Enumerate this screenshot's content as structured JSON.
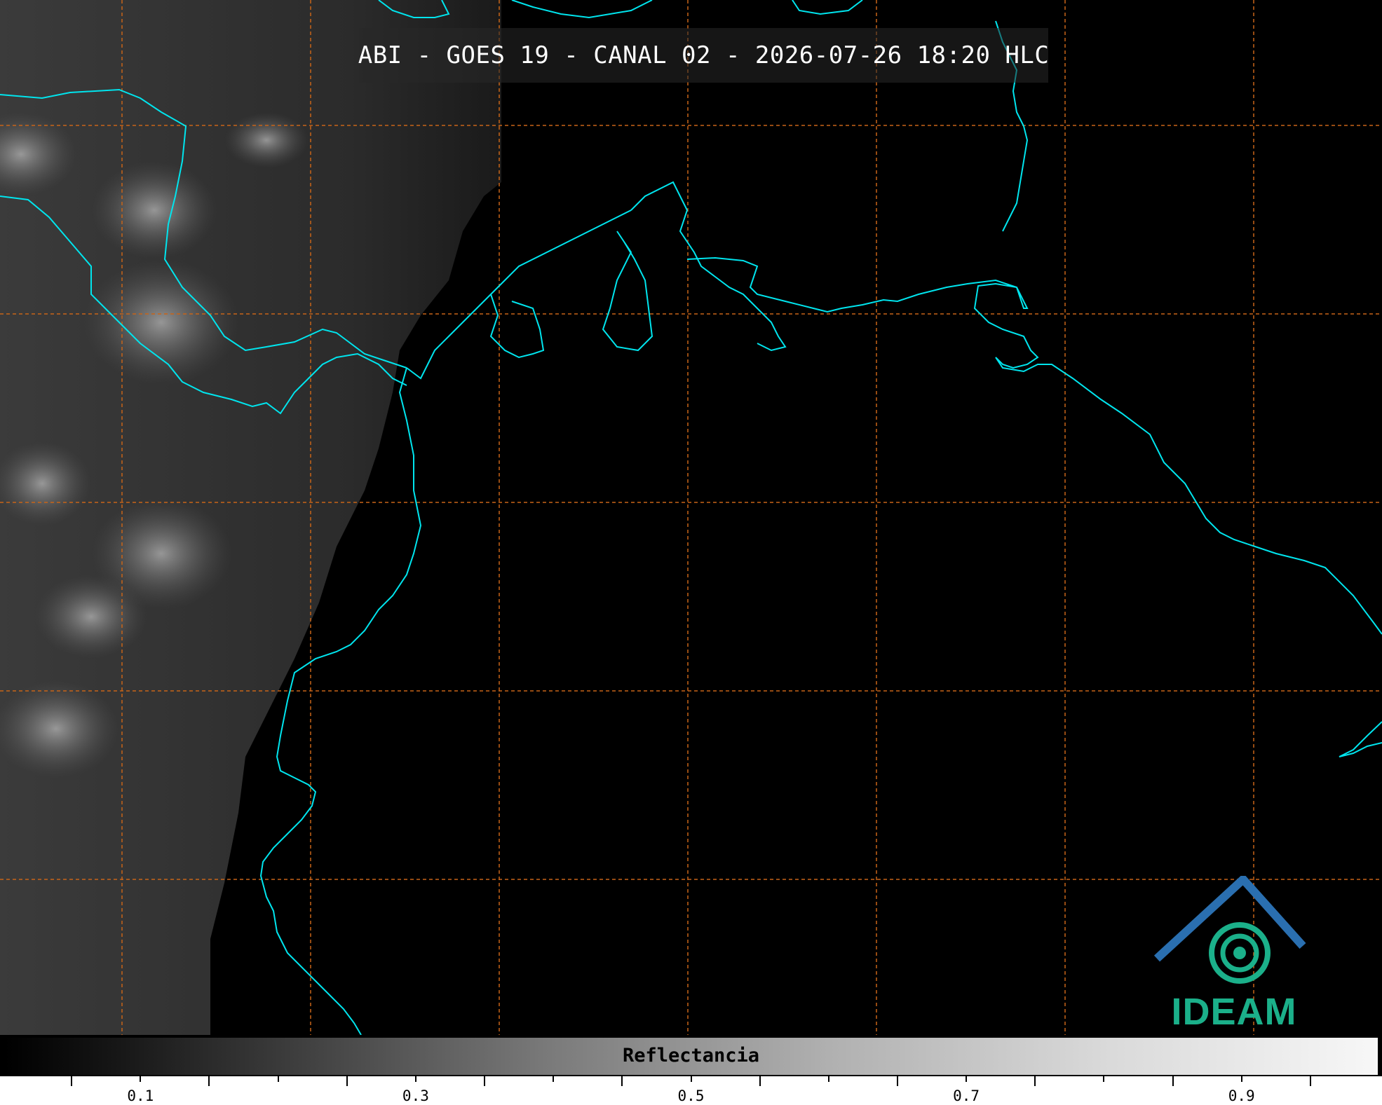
{
  "title": "ABI - GOES 19 - CANAL 02 - 2026-07-26 18:20 HLC",
  "colorbar": {
    "label": "Reflectancia",
    "tick_labels": [
      "0.1",
      "0.3",
      "0.5",
      "0.7",
      "0.9"
    ],
    "range": [
      0.0,
      1.0
    ]
  },
  "logo": {
    "text": "IDEAM"
  },
  "colors": {
    "coastline": "#00e5ee",
    "gridline": "#c86418",
    "title_text": "#ffffff",
    "logo_green": "#1bb08a",
    "logo_blue": "#2a6fb0"
  }
}
